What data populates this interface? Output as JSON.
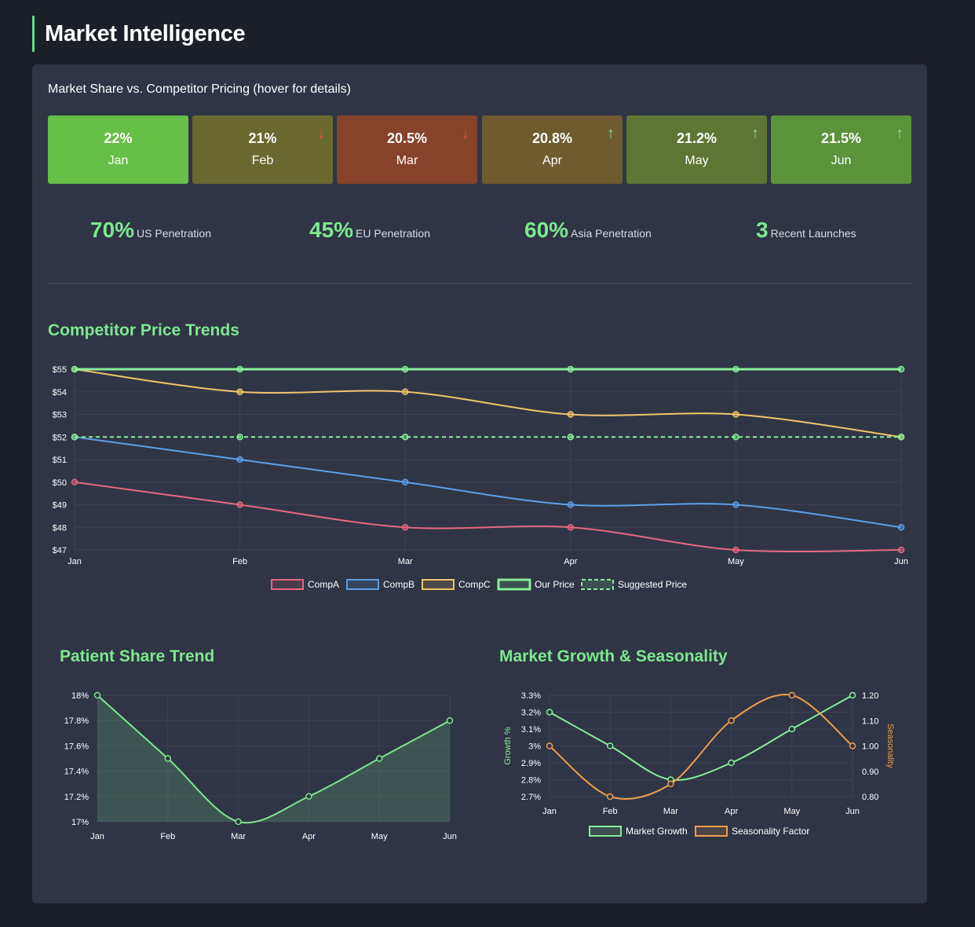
{
  "header": {
    "title": "Market Intelligence"
  },
  "panel": {
    "subtitle": "Market Share vs. Competitor Pricing (hover for details)"
  },
  "months": [
    {
      "value": "22%",
      "label": "Jan",
      "arrow": "",
      "color": "#66bf47"
    },
    {
      "value": "21%",
      "label": "Feb",
      "arrow": "↓",
      "color": "#69692f"
    },
    {
      "value": "20.5%",
      "label": "Mar",
      "arrow": "↓",
      "color": "#86422b"
    },
    {
      "value": "20.8%",
      "label": "Apr",
      "arrow": "↑",
      "color": "#6f5b2f"
    },
    {
      "value": "21.2%",
      "label": "May",
      "arrow": "↑",
      "color": "#5f7533"
    },
    {
      "value": "21.5%",
      "label": "Jun",
      "arrow": "↑",
      "color": "#5a933a"
    }
  ],
  "kpis": [
    {
      "value": "70%",
      "label": "US Penetration"
    },
    {
      "value": "45%",
      "label": "EU Penetration"
    },
    {
      "value": "60%",
      "label": "Asia Penetration"
    },
    {
      "value": "3",
      "label": "Recent Launches"
    }
  ],
  "colors": {
    "accent": "#7de88f",
    "down": "#ee4b4b",
    "up": "#7de88f",
    "compA": "#e5677d",
    "compB": "#5c9ee6",
    "compC": "#efc56b",
    "our": "#86ee98",
    "growth": "#86ee98",
    "seasonality": "#ed9f4e"
  },
  "sections": {
    "price_trends": "Competitor Price Trends",
    "patient_share": "Patient Share Trend",
    "market_growth": "Market Growth & Seasonality"
  },
  "chart_data": [
    {
      "type": "line",
      "title": "Competitor Price Trends",
      "categories": [
        "Jan",
        "Feb",
        "Mar",
        "Apr",
        "May",
        "Jun"
      ],
      "ylim": [
        47,
        55
      ],
      "yticks": [
        "$55",
        "$54",
        "$53",
        "$52",
        "$51",
        "$50",
        "$49",
        "$48",
        "$47"
      ],
      "grid": true,
      "legend": "bottom",
      "series": [
        {
          "name": "CompA",
          "values": [
            50,
            49,
            48,
            48,
            47,
            47
          ]
        },
        {
          "name": "CompB",
          "values": [
            52,
            51,
            50,
            49,
            49,
            48
          ]
        },
        {
          "name": "CompC",
          "values": [
            55,
            54,
            54,
            53,
            53,
            52
          ]
        },
        {
          "name": "Our Price",
          "values": [
            55,
            55,
            55,
            55,
            55,
            55
          ]
        },
        {
          "name": "Suggested Price",
          "values": [
            52,
            52,
            52,
            52,
            52,
            52
          ],
          "dashed": true
        }
      ]
    },
    {
      "type": "area",
      "title": "Patient Share Trend",
      "categories": [
        "Jan",
        "Feb",
        "Mar",
        "Apr",
        "May",
        "Jun"
      ],
      "ylim": [
        17,
        18
      ],
      "yticks": [
        "18%",
        "17.8%",
        "17.6%",
        "17.4%",
        "17.2%",
        "17%"
      ],
      "grid": true,
      "series": [
        {
          "values": [
            18,
            17.5,
            17,
            17.2,
            17.5,
            17.8
          ]
        }
      ]
    },
    {
      "type": "line",
      "title": "Market Growth & Seasonality",
      "categories": [
        "Jan",
        "Feb",
        "Mar",
        "Apr",
        "May",
        "Jun"
      ],
      "ylim": [
        2.7,
        3.3
      ],
      "y2lim": [
        0.8,
        1.2
      ],
      "ylabel": "Growth %",
      "y2label": "Seasonality",
      "yticks": [
        "3.3%",
        "3.2%",
        "3.1%",
        "3%",
        "2.9%",
        "2.8%",
        "2.7%"
      ],
      "y2ticks": [
        "1.20",
        "1.10",
        "1.00",
        "0.90",
        "0.80"
      ],
      "grid": true,
      "legend": "bottom",
      "series": [
        {
          "name": "Market Growth",
          "values": [
            3.2,
            3.0,
            2.8,
            2.9,
            3.1,
            3.3
          ],
          "axis": "left"
        },
        {
          "name": "Seasonality Factor",
          "values": [
            1.0,
            0.8,
            0.85,
            1.1,
            1.2,
            1.0
          ],
          "axis": "right"
        }
      ]
    }
  ]
}
